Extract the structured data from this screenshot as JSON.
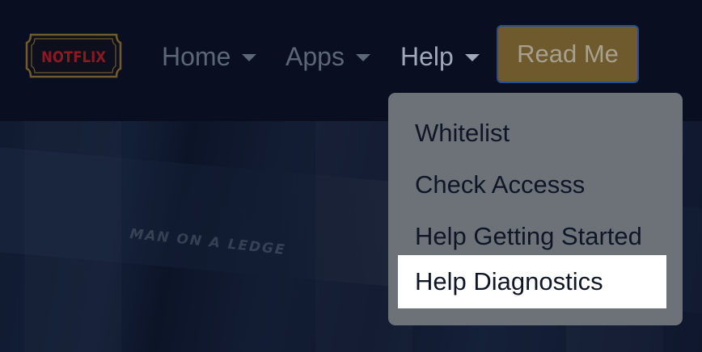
{
  "brand": {
    "logo_text": "NOTFLIX"
  },
  "nav": {
    "items": [
      {
        "label": "Home",
        "has_caret": true
      },
      {
        "label": "Apps",
        "has_caret": true
      },
      {
        "label": "Help",
        "has_caret": true,
        "active": true
      }
    ],
    "read_me_label": "Read Me"
  },
  "help_menu": {
    "items": [
      {
        "label": "Whitelist"
      },
      {
        "label": "Check Accesss"
      },
      {
        "label": "Help Getting Started"
      },
      {
        "label": "Help Diagnostics",
        "highlighted": true
      }
    ]
  },
  "hero": {
    "caption": "MAN ON A LEDGE"
  },
  "colors": {
    "background": "#0b1326",
    "button_bg": "#6e5a2c",
    "button_border": "#274c8f",
    "dropdown_bg": "#6d7178",
    "highlight_bg": "#ffffff"
  }
}
